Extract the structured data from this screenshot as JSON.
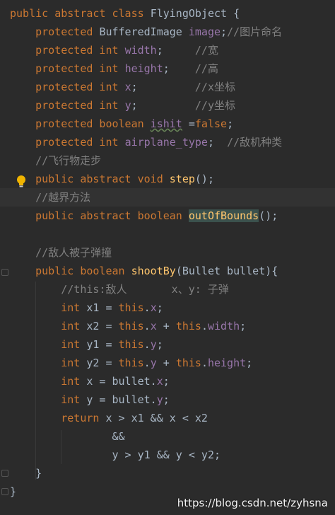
{
  "editor": {
    "theme_colors": {
      "background": "#2b2b2b",
      "keyword": "#cc7832",
      "field": "#9876aa",
      "method": "#ffc66d",
      "comment": "#808080",
      "plain": "#a9b7c6"
    },
    "lines": [
      {
        "t": [
          [
            "kw",
            "public abstract class "
          ],
          [
            "plain",
            "FlyingObject {"
          ]
        ]
      },
      {
        "t": [
          [
            "kw",
            "    protected "
          ],
          [
            "plain",
            "BufferedImage "
          ],
          [
            "field",
            "image"
          ],
          [
            "plain",
            ";"
          ],
          [
            "comment",
            "//图片命名"
          ]
        ]
      },
      {
        "t": [
          [
            "kw",
            "    protected int "
          ],
          [
            "field",
            "width"
          ],
          [
            "plain",
            ";     "
          ],
          [
            "comment",
            "//宽"
          ]
        ]
      },
      {
        "t": [
          [
            "kw",
            "    protected int "
          ],
          [
            "field",
            "height"
          ],
          [
            "plain",
            ";    "
          ],
          [
            "comment",
            "//高"
          ]
        ]
      },
      {
        "t": [
          [
            "kw",
            "    protected int "
          ],
          [
            "field",
            "x"
          ],
          [
            "plain",
            ";         "
          ],
          [
            "comment",
            "//x坐标"
          ]
        ]
      },
      {
        "t": [
          [
            "kw",
            "    protected int "
          ],
          [
            "field",
            "y"
          ],
          [
            "plain",
            ";         "
          ],
          [
            "comment",
            "//y坐标"
          ]
        ]
      },
      {
        "t": [
          [
            "kw",
            "    protected boolean "
          ],
          [
            "fieldwarn",
            "ishit"
          ],
          [
            "plain",
            " ="
          ],
          [
            "kw",
            "false"
          ],
          [
            "plain",
            ";"
          ]
        ]
      },
      {
        "t": [
          [
            "kw",
            "    protected int "
          ],
          [
            "field",
            "airplane_type"
          ],
          [
            "plain",
            ";  "
          ],
          [
            "comment",
            "//敌机种类"
          ]
        ]
      },
      {
        "t": [
          [
            "comment",
            "    //飞行物走步"
          ]
        ]
      },
      {
        "t": [
          [
            "kw",
            "    public abstract void "
          ],
          [
            "method",
            "step"
          ],
          [
            "plain",
            "();"
          ]
        ]
      },
      {
        "t": [
          [
            "comment",
            "    //越界方法"
          ]
        ]
      },
      {
        "t": [
          [
            "kw",
            "    public abstract boolean "
          ],
          [
            "methodhl",
            "outOfBounds"
          ],
          [
            "plain",
            "();"
          ]
        ]
      },
      {
        "t": [
          [
            "plain",
            ""
          ]
        ]
      },
      {
        "t": [
          [
            "comment",
            "    //敌人被子弹撞"
          ]
        ]
      },
      {
        "t": [
          [
            "kw",
            "    public boolean "
          ],
          [
            "method",
            "shootBy"
          ],
          [
            "plain",
            "(Bullet bullet){"
          ]
        ]
      },
      {
        "t": [
          [
            "comment",
            "        //this:敌人       x、y: 子弹"
          ]
        ]
      },
      {
        "t": [
          [
            "kw",
            "        int "
          ],
          [
            "plain",
            "x1 = "
          ],
          [
            "kw",
            "this"
          ],
          [
            "plain",
            "."
          ],
          [
            "field",
            "x"
          ],
          [
            "plain",
            ";"
          ]
        ]
      },
      {
        "t": [
          [
            "kw",
            "        int "
          ],
          [
            "plain",
            "x2 = "
          ],
          [
            "kw",
            "this"
          ],
          [
            "plain",
            "."
          ],
          [
            "field",
            "x"
          ],
          [
            "plain",
            " + "
          ],
          [
            "kw",
            "this"
          ],
          [
            "plain",
            "."
          ],
          [
            "field",
            "width"
          ],
          [
            "plain",
            ";"
          ]
        ]
      },
      {
        "t": [
          [
            "kw",
            "        int "
          ],
          [
            "plain",
            "y1 = "
          ],
          [
            "kw",
            "this"
          ],
          [
            "plain",
            "."
          ],
          [
            "field",
            "y"
          ],
          [
            "plain",
            ";"
          ]
        ]
      },
      {
        "t": [
          [
            "kw",
            "        int "
          ],
          [
            "plain",
            "y2 = "
          ],
          [
            "kw",
            "this"
          ],
          [
            "plain",
            "."
          ],
          [
            "field",
            "y"
          ],
          [
            "plain",
            " + "
          ],
          [
            "kw",
            "this"
          ],
          [
            "plain",
            "."
          ],
          [
            "field",
            "height"
          ],
          [
            "plain",
            ";"
          ]
        ]
      },
      {
        "t": [
          [
            "kw",
            "        int "
          ],
          [
            "plain",
            "x = bullet."
          ],
          [
            "field",
            "x"
          ],
          [
            "plain",
            ";"
          ]
        ]
      },
      {
        "t": [
          [
            "kw",
            "        int "
          ],
          [
            "plain",
            "y = bullet."
          ],
          [
            "field",
            "y"
          ],
          [
            "plain",
            ";"
          ]
        ]
      },
      {
        "t": [
          [
            "kw",
            "        return "
          ],
          [
            "plain",
            "x > x1 && x < x2"
          ]
        ]
      },
      {
        "t": [
          [
            "plain",
            "                &&"
          ]
        ]
      },
      {
        "t": [
          [
            "plain",
            "                y > y1 && y < y2;"
          ]
        ]
      },
      {
        "t": [
          [
            "plain",
            "    }"
          ]
        ]
      },
      {
        "t": [
          [
            "plain",
            "}"
          ]
        ]
      }
    ]
  },
  "watermark": "https://blog.csdn.net/zyhsna"
}
